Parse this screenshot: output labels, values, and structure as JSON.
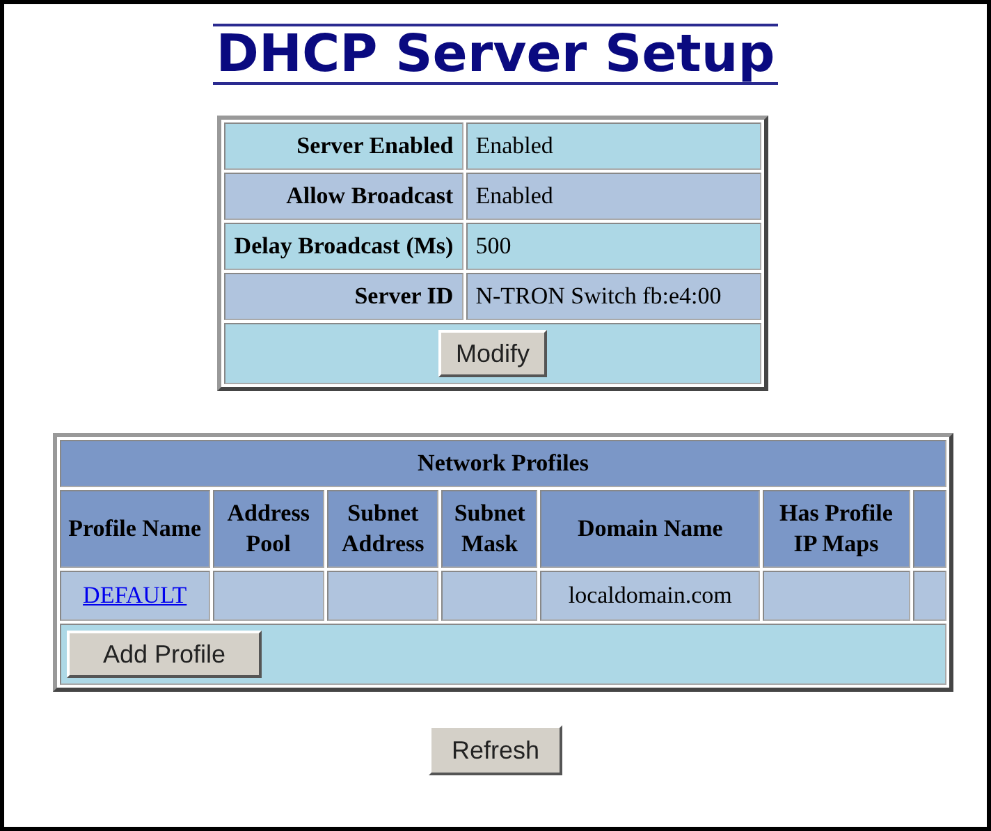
{
  "title": "DHCP Server Setup",
  "server_settings": {
    "rows": [
      {
        "label": "Server Enabled",
        "value": "Enabled"
      },
      {
        "label": "Allow Broadcast",
        "value": "Enabled"
      },
      {
        "label": "Delay Broadcast (Ms)",
        "value": "500"
      },
      {
        "label": "Server ID",
        "value": "N-TRON Switch fb:e4:00"
      }
    ],
    "button": "Modify"
  },
  "network_profiles": {
    "title": "Network Profiles",
    "columns": [
      "Profile Name",
      "Address Pool",
      "Subnet Address",
      "Subnet Mask",
      "Domain Name",
      "Has Profile IP Maps",
      null
    ],
    "rows": [
      {
        "cells": [
          "DEFAULT",
          null,
          null,
          null,
          "localdomain.com",
          null,
          null
        ]
      }
    ],
    "button": "Add Profile"
  },
  "refresh_button": "Refresh"
}
